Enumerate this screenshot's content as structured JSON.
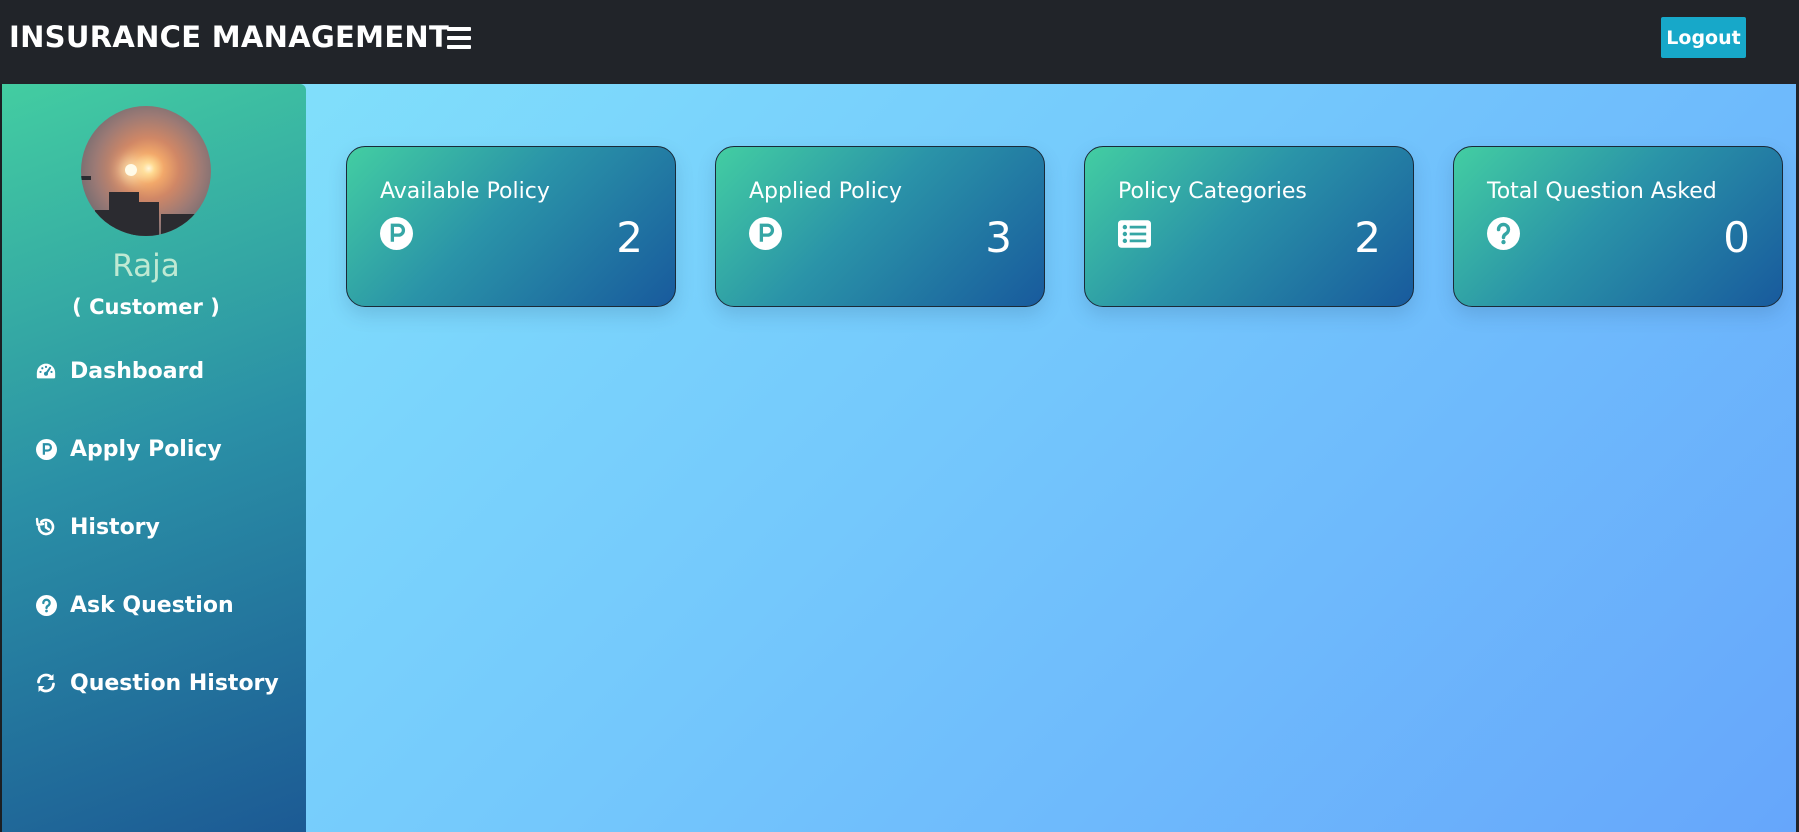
{
  "header": {
    "brand": "INSURANCE MANAGEMENT",
    "menu_icon": "hamburger-menu-icon",
    "logout_label": "Logout"
  },
  "sidebar": {
    "avatar": "sunset-cityscape-profile-photo",
    "username": "Raja",
    "role": "( Customer )",
    "items": [
      {
        "label": "Dashboard",
        "icon": "tachometer-icon"
      },
      {
        "label": "Apply Policy",
        "icon": "parking-circle-icon"
      },
      {
        "label": "History",
        "icon": "history-icon"
      },
      {
        "label": "Ask Question",
        "icon": "question-circle-icon"
      },
      {
        "label": "Question History",
        "icon": "sync-icon"
      }
    ]
  },
  "cards": [
    {
      "title": "Available Policy",
      "count": "2",
      "icon": "parking-circle-icon"
    },
    {
      "title": "Applied Policy",
      "count": "3",
      "icon": "parking-circle-icon"
    },
    {
      "title": "Policy Categories",
      "count": "2",
      "icon": "list-alt-icon"
    },
    {
      "title": "Total Question Asked",
      "count": "0",
      "icon": "question-circle-icon"
    }
  ],
  "colors": {
    "topbar": "#212429",
    "logout_button": "#17a8c9",
    "card_gradient_start": "#43cea2",
    "card_gradient_end": "#185a9d",
    "background_gradient_start": "#84e6fb",
    "background_gradient_end": "#66a6fb"
  }
}
